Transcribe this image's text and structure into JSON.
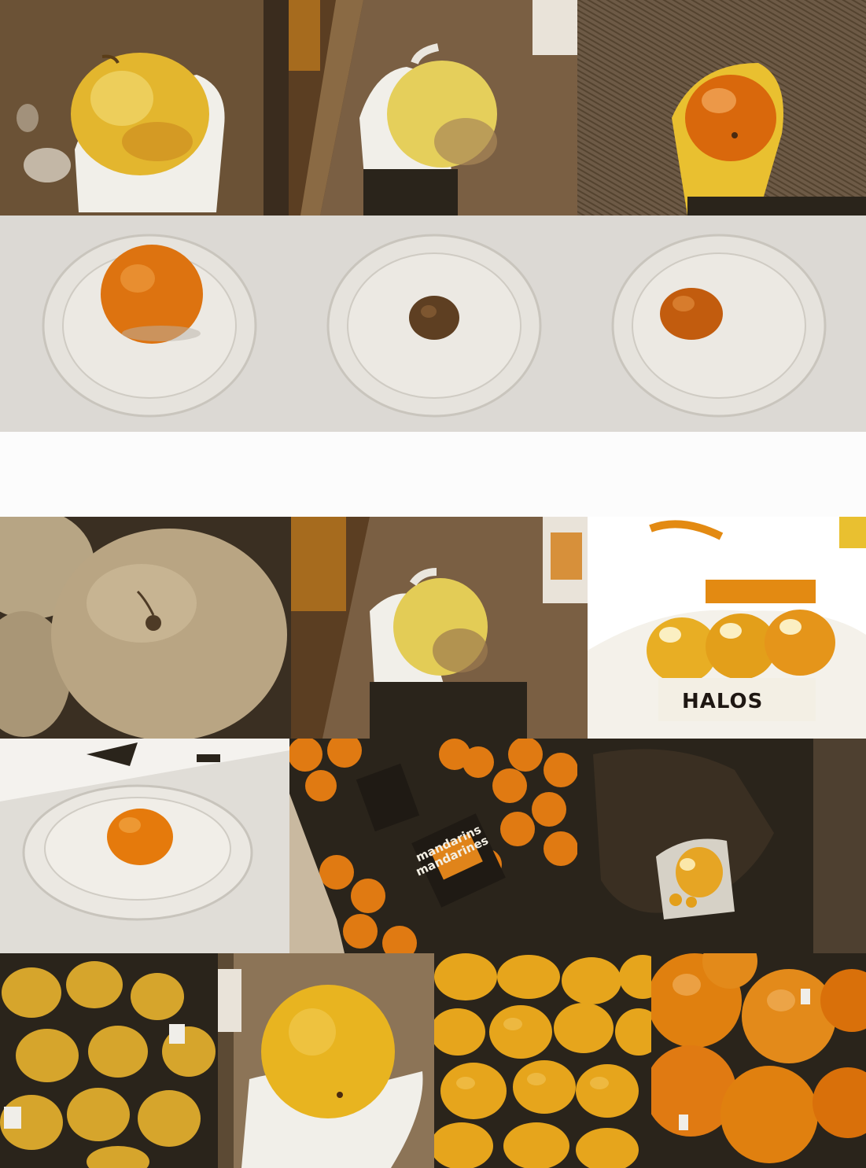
{
  "image": {
    "description_free": true,
    "groups": [
      {
        "name": "top-group",
        "rows": 2,
        "cols": 3
      },
      {
        "name": "bottom-group",
        "rows": 3
      }
    ]
  },
  "labels": {
    "bag_brand": "HALOS",
    "mandarins_en": "mandarins",
    "mandarins_fr": "mandarines"
  },
  "colors": {
    "background": "#fcfcfc",
    "orange": "#e07a12",
    "dark_orange": "#b85a06",
    "yellow": "#e9be2e",
    "pale_yellow": "#e9d77a",
    "dark": "#2a241b",
    "plate": "#e6e3dd",
    "table": "#dcd9d4",
    "floor_brown": "#6b5236"
  }
}
